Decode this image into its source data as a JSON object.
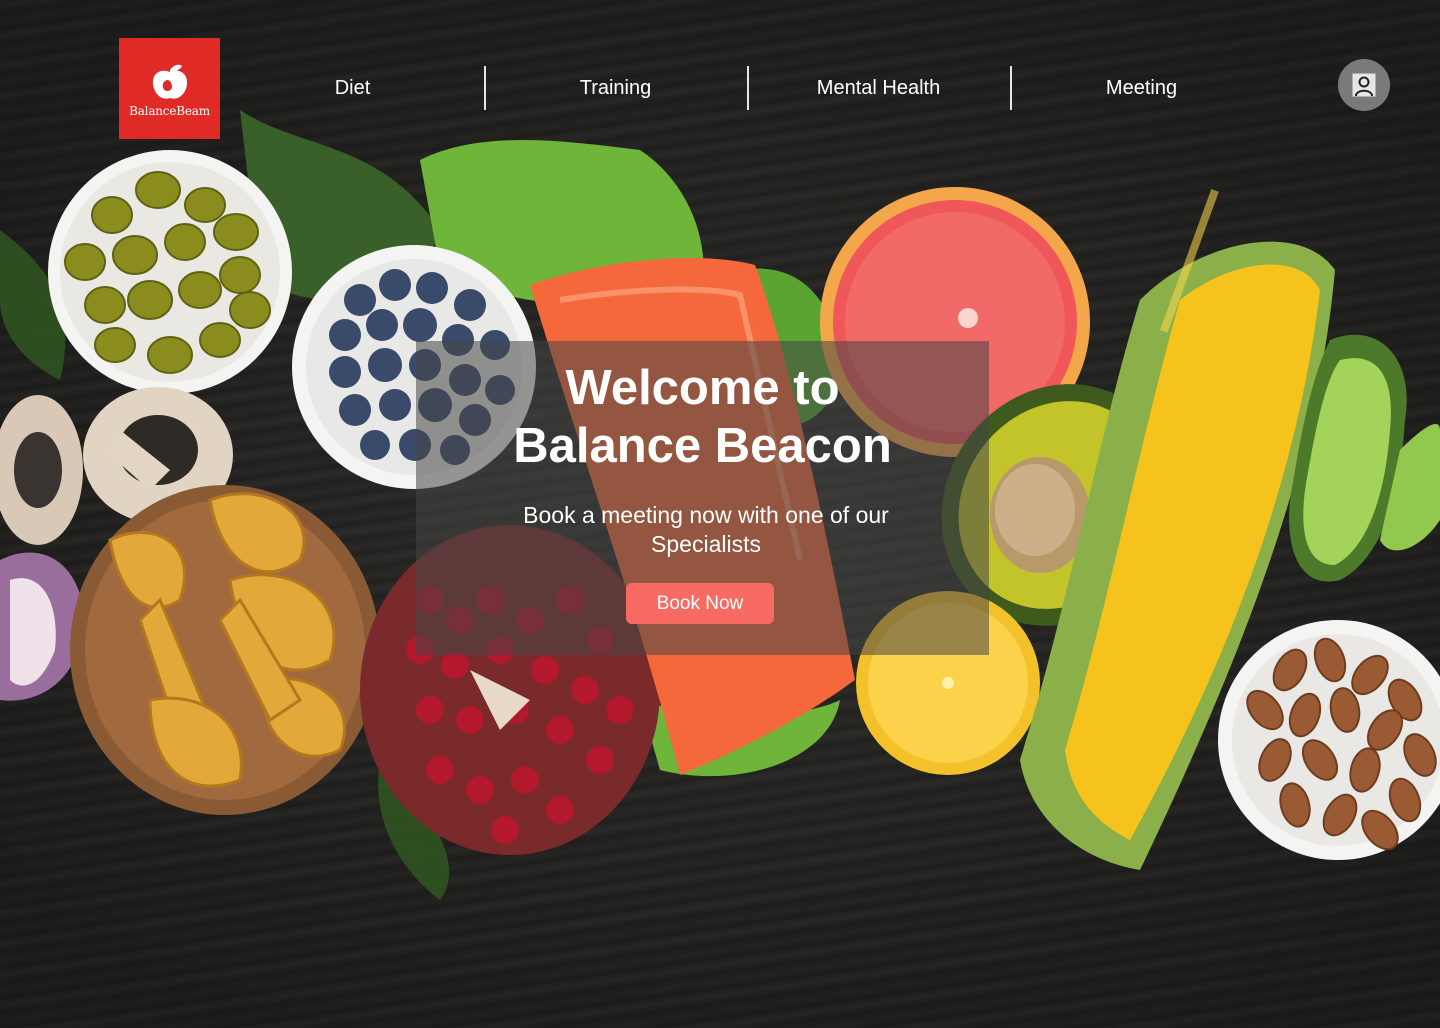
{
  "brand": {
    "logo_text": "BalanceBeam",
    "logo_color": "#e02a26"
  },
  "nav": {
    "items": [
      {
        "label": "Diet"
      },
      {
        "label": "Training"
      },
      {
        "label": "Mental Health"
      },
      {
        "label": "Meeting"
      }
    ]
  },
  "profile": {
    "icon": "user-icon"
  },
  "hero": {
    "title_line1": "Welcome to",
    "title_line2": "Balance Beacon",
    "subtitle": "Book a meeting now with one of our Specialists",
    "cta_label": "Book Now",
    "cta_color": "#f76b62"
  }
}
